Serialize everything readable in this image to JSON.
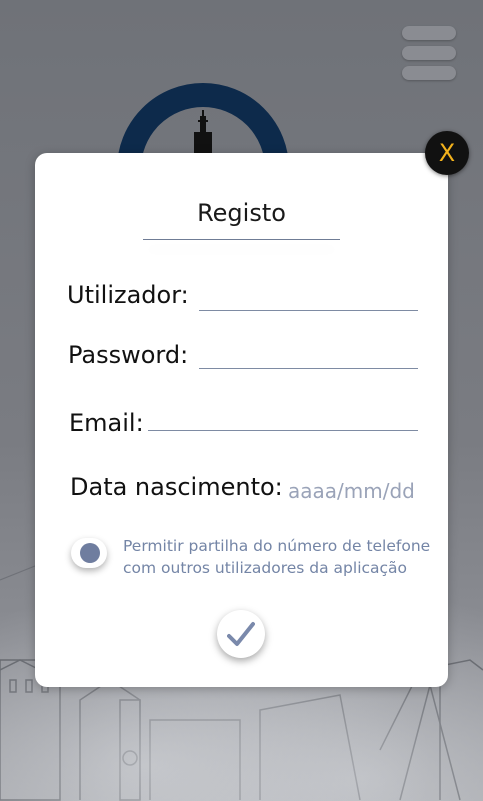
{
  "modal": {
    "title": "Registo",
    "close_label": "X",
    "fields": {
      "username_label": "Utilizador:",
      "password_label": "Password:",
      "email_label": "Email:",
      "birthdate_label": "Data nascimento:",
      "birthdate_placeholder": "aaaa/mm/dd"
    },
    "share_phone_toggle": {
      "line1": "Permitir partilha do número de telefone",
      "line2": "com outros utilizadores da aplicação"
    },
    "submit_icon": "checkmark-icon"
  },
  "header": {
    "menu_icon": "hamburger-menu-icon"
  },
  "colors": {
    "accent": "#f3b21c",
    "field_line": "#7e8ba3",
    "toggle_text": "#7485a6",
    "logo_ring": "#0d2a4b"
  }
}
